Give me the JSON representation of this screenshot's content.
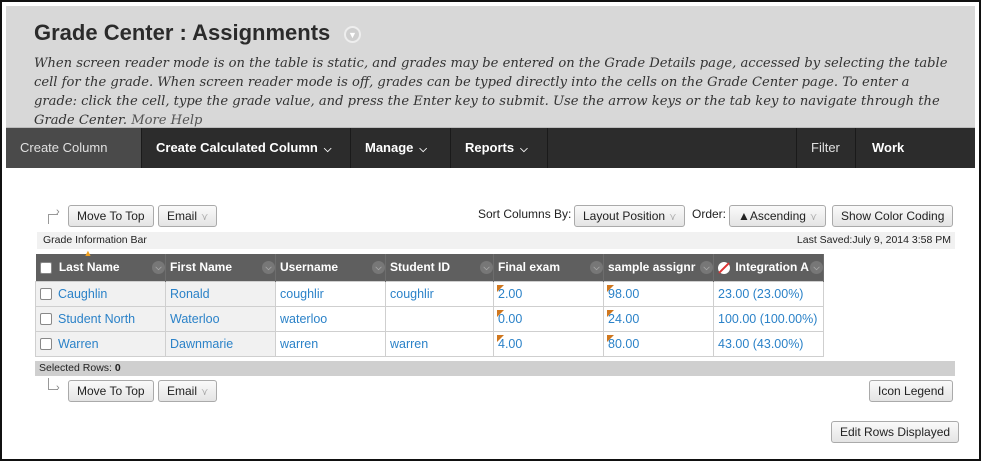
{
  "header": {
    "title": "Grade Center : Assignments",
    "help_text": "When screen reader mode is on the table is static, and grades may be entered on the Grade Details page, accessed by selecting the table cell for the grade. When screen reader mode is off, grades can be typed directly into the cells on the Grade Center page. To enter a grade: click the cell, type the grade value, and press the Enter key to submit. Use the arrow keys or the tab key to navigate through the Grade Center.",
    "help_link": "More Help"
  },
  "actionbar": {
    "create_column": "Create Column",
    "create_calculated": "Create Calculated Column",
    "manage": "Manage",
    "reports": "Reports",
    "filter": "Filter",
    "work_offline": "Work Offline"
  },
  "toolbar": {
    "move_to_top": "Move To Top",
    "email": "Email",
    "sort_label": "Sort Columns By:",
    "sort_value": "Layout Position",
    "order_label": "Order:",
    "order_value": "▲Ascending",
    "color_coding": "Show Color Coding"
  },
  "info_bar": {
    "label": "Grade Information Bar",
    "last_saved": "Last Saved:July 9, 2014 3:58 PM"
  },
  "table": {
    "headers": [
      "Last Name",
      "First Name",
      "Username",
      "Student ID",
      "Final exam",
      "sample assignr",
      "Integration A"
    ],
    "rows": [
      [
        "Caughlin",
        "Ronald",
        "coughlir",
        "coughlir",
        "2.00",
        "98.00",
        "23.00 (23.00%)"
      ],
      [
        "Student North",
        "Waterloo",
        "waterloo",
        "",
        "0.00",
        "24.00",
        "100.00 (100.00%)"
      ],
      [
        "Warren",
        "Dawnmarie",
        "warren",
        "warren",
        "4.00",
        "80.00",
        "43.00 (43.00%)"
      ]
    ]
  },
  "footer": {
    "selected_rows_label": "Selected Rows:",
    "selected_rows_count": "0",
    "icon_legend": "Icon Legend",
    "edit_rows": "Edit Rows Displayed"
  }
}
